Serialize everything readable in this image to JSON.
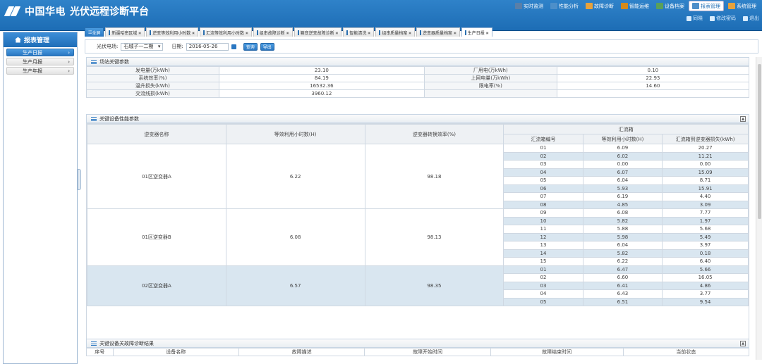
{
  "header": {
    "brand": "中国华电",
    "system": "光伏远程诊断平台",
    "nav": [
      {
        "label": "实时监测",
        "icon": "monitor-icon",
        "color": "#5a7fa8"
      },
      {
        "label": "性能分析",
        "icon": "chart-icon",
        "color": "#4d8fc9"
      },
      {
        "label": "故障诊断",
        "icon": "fault-icon",
        "color": "#e6a23c"
      },
      {
        "label": "智能运维",
        "icon": "maintenance-icon",
        "color": "#d48a1a"
      },
      {
        "label": "设备档案",
        "icon": "device-icon",
        "color": "#5aa05a"
      },
      {
        "label": "报表管理",
        "icon": "report-icon",
        "color": "#4d8fc9"
      },
      {
        "label": "系统管理",
        "icon": "system-icon",
        "color": "#e6a23c"
      }
    ],
    "user": {
      "name": "同晓",
      "change_password": "修改密码",
      "logout": "退出"
    }
  },
  "sidebar": {
    "title": "报表管理",
    "items": [
      {
        "label": "生产日报",
        "active": true
      },
      {
        "label": "生产月报",
        "active": false
      },
      {
        "label": "生产年报",
        "active": false
      }
    ]
  },
  "tabs": [
    {
      "label": "全屏",
      "first": true
    },
    {
      "label": "新疆哈密区域"
    },
    {
      "label": "逆变等效利用小时数"
    },
    {
      "label": "汇流等效利用小时数"
    },
    {
      "label": "组串故障诊断"
    },
    {
      "label": "箱变逆变故障诊断"
    },
    {
      "label": "智能清洗"
    },
    {
      "label": "组串质量档案"
    },
    {
      "label": "逆变器质量档案"
    },
    {
      "label": "生产日报",
      "active": true
    }
  ],
  "toolbar": {
    "station_label": "光伏电场:",
    "station_value": "石城子一二期",
    "date_label": "日期:",
    "date_value": "2016-05-26",
    "query_button": "查询",
    "export_button": "导出"
  },
  "key_params": {
    "title": "场站关键参数",
    "rows": [
      [
        "发电量(万kWh)",
        "23.10",
        "厂用电(万kWh)",
        "0.10"
      ],
      [
        "系统效率(%)",
        "84.19",
        "上网电量(万kWh)",
        "22.93"
      ],
      [
        "温升损失(kWh)",
        "16532.36",
        "限电率(%)",
        "14.60"
      ],
      [
        "交流线损(kWh)",
        "3960.12",
        "",
        ""
      ]
    ]
  },
  "device_perf": {
    "title": "关键设备性能参数",
    "headers": {
      "inverter_name": "逆变器名称",
      "equiv_hours": "等效利用小时数(H)",
      "efficiency": "逆变器转换效率(%)",
      "combiner": "汇流箱",
      "combiner_no": "汇流箱编号",
      "combiner_hours": "等效利用小时数(H)",
      "combiner_loss": "汇流箱到逆变器损失(kWh)"
    },
    "groups": [
      {
        "name": "01区逆变器A",
        "hours": "6.22",
        "eff": "98.18",
        "shaded": false,
        "rows": [
          [
            "01",
            "6.09",
            "20.27"
          ],
          [
            "02",
            "6.02",
            "11.21"
          ],
          [
            "03",
            "0.00",
            "0.00"
          ],
          [
            "04",
            "6.07",
            "15.09"
          ],
          [
            "05",
            "6.04",
            "8.71"
          ],
          [
            "06",
            "5.93",
            "15.91"
          ],
          [
            "07",
            "6.19",
            "4.40"
          ],
          [
            "08",
            "4.85",
            "3.09"
          ]
        ]
      },
      {
        "name": "01区逆变器B",
        "hours": "6.08",
        "eff": "98.13",
        "shaded": false,
        "rows": [
          [
            "09",
            "6.08",
            "7.77"
          ],
          [
            "10",
            "5.82",
            "1.97"
          ],
          [
            "11",
            "5.88",
            "5.68"
          ],
          [
            "12",
            "5.98",
            "5.49"
          ],
          [
            "13",
            "6.04",
            "3.97"
          ],
          [
            "14",
            "5.82",
            "0.18"
          ],
          [
            "15",
            "6.22",
            "6.40"
          ]
        ]
      },
      {
        "name": "02区逆变器A",
        "hours": "6.57",
        "eff": "98.35",
        "shaded": true,
        "rows": [
          [
            "01",
            "6.47",
            "5.66"
          ],
          [
            "02",
            "6.60",
            "16.05"
          ],
          [
            "03",
            "6.41",
            "4.86"
          ],
          [
            "04",
            "6.43",
            "3.77"
          ],
          [
            "05",
            "6.51",
            "9.54"
          ]
        ]
      }
    ]
  },
  "fault_results": {
    "title": "关键设备关故障诊断结果",
    "headers": [
      "序号",
      "设备名称",
      "故障描述",
      "故障开始时间",
      "故障结束时间",
      "当前状态"
    ]
  },
  "colors": {
    "header_blue": "#1d6db5",
    "accent": "#2a77c2",
    "row_shade": "#d9e6f0"
  }
}
